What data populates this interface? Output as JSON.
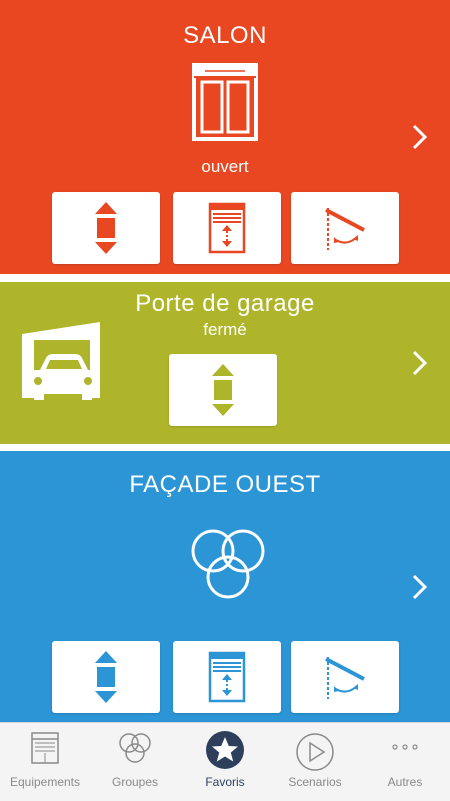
{
  "colors": {
    "salon": "#e84721",
    "garage": "#afb52b",
    "facade": "#2b95d6",
    "tab_inactive": "#8a8a8a",
    "tab_active": "#2d3f5b"
  },
  "cards": [
    {
      "title": "SALON",
      "status": "ouvert",
      "icon": "window-icon",
      "controls": [
        "up-down-arrows-icon",
        "blind-position-icon",
        "slat-tilt-icon"
      ]
    },
    {
      "title": "Porte de garage",
      "status": "fermé",
      "icon": "garage-car-icon",
      "controls": [
        "up-down-arrows-icon"
      ]
    },
    {
      "title": "FAÇADE OUEST",
      "icon": "group-circles-icon",
      "controls": [
        "up-down-arrows-icon",
        "blind-position-icon",
        "slat-tilt-icon"
      ]
    }
  ],
  "tabbar": {
    "active": "Favoris",
    "items": [
      {
        "label": "Equipements",
        "icon": "equipment-icon"
      },
      {
        "label": "Groupes",
        "icon": "groups-icon"
      },
      {
        "label": "Favoris",
        "icon": "star-icon"
      },
      {
        "label": "Scenarios",
        "icon": "play-icon"
      },
      {
        "label": "Autres",
        "icon": "more-icon"
      }
    ]
  }
}
